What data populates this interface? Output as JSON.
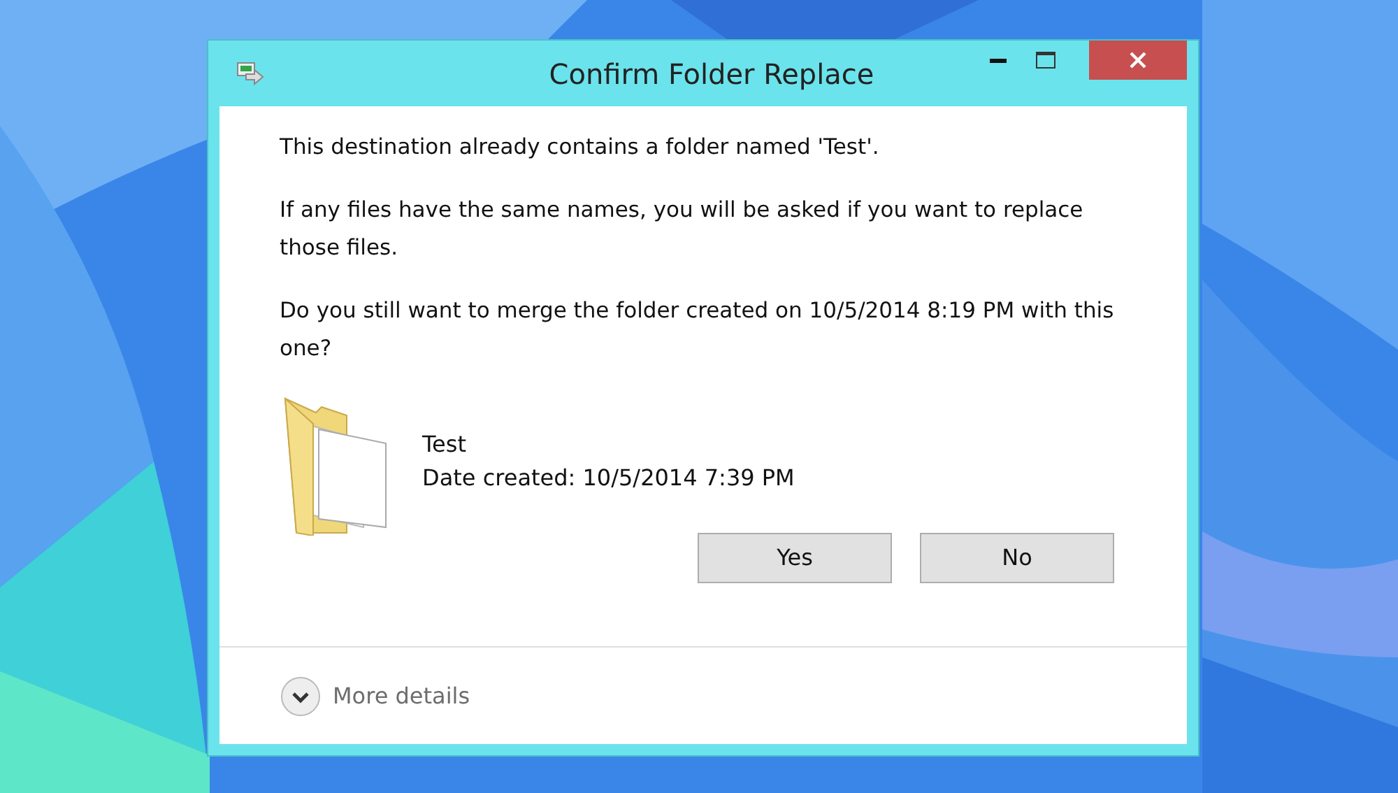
{
  "window": {
    "title": "Confirm Folder Replace"
  },
  "messages": [
    "This destination already contains a folder named 'Test'.",
    "If any files have the same names, you will be asked if you want to replace those files.",
    "Do you still want to merge the folder created on 10/5/2014 8:19 PM with this one?"
  ],
  "folder": {
    "name": "Test",
    "date": "Date created: 10/5/2014 7:39 PM"
  },
  "buttons": [
    "Yes",
    "No"
  ],
  "details": {
    "label": "More details",
    "expanded": false
  }
}
